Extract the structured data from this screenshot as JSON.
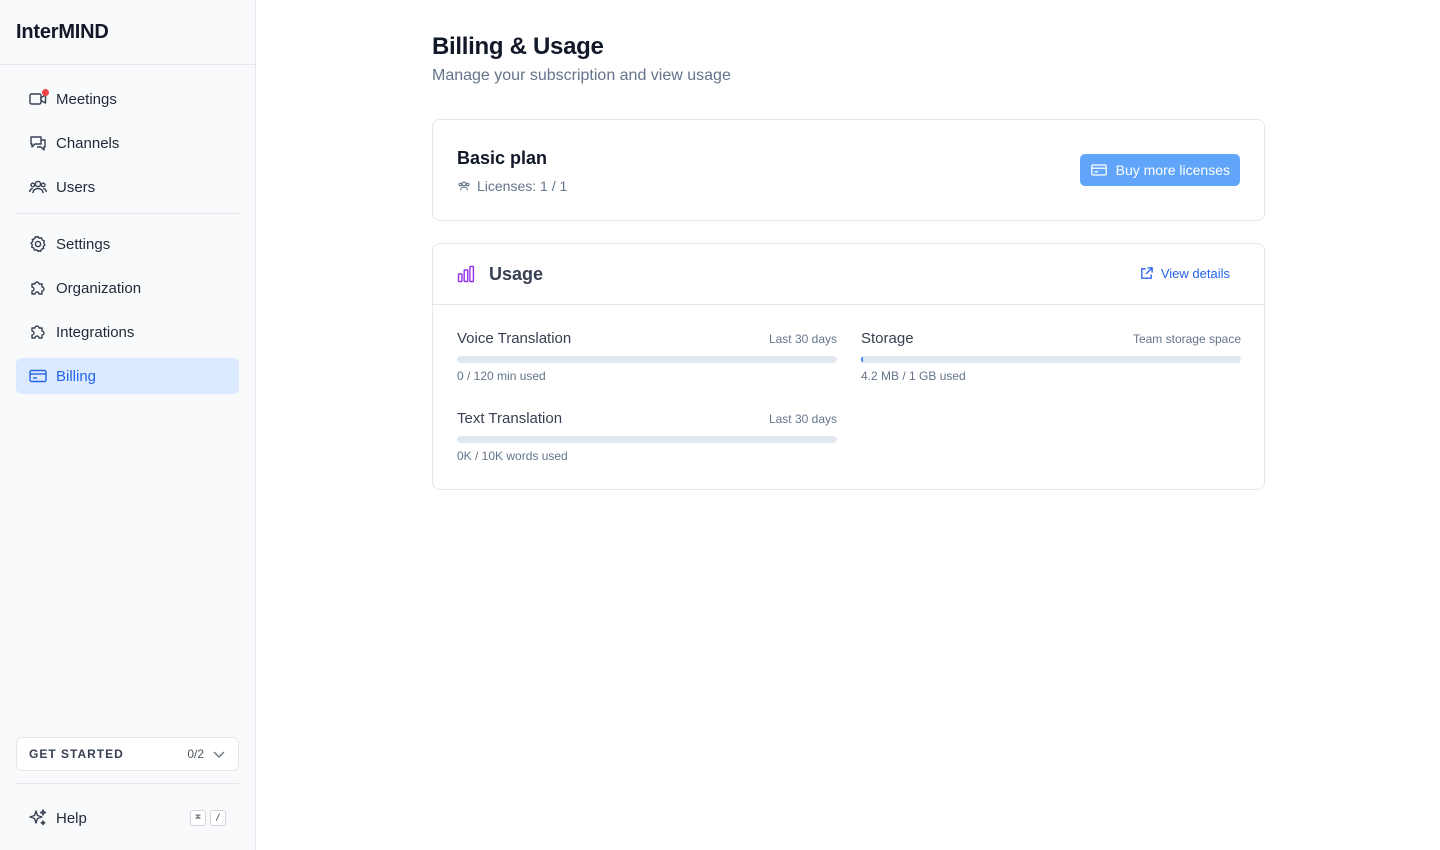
{
  "app": {
    "name": "InterMIND"
  },
  "sidebar": {
    "primary": [
      {
        "label": "Meetings",
        "icon": "video-camera-icon",
        "has_notification": true
      },
      {
        "label": "Channels",
        "icon": "chat-bubbles-icon"
      },
      {
        "label": "Users",
        "icon": "users-icon"
      }
    ],
    "secondary": [
      {
        "label": "Settings",
        "icon": "gear-icon"
      },
      {
        "label": "Organization",
        "icon": "puzzle-icon"
      },
      {
        "label": "Integrations",
        "icon": "puzzle-icon"
      },
      {
        "label": "Billing",
        "icon": "credit-card-icon",
        "active": true
      }
    ],
    "get_started": {
      "label": "GET STARTED",
      "count": "0/2"
    },
    "help": {
      "label": "Help",
      "shortcut_keys": [
        "⌘",
        "/"
      ]
    }
  },
  "page": {
    "title": "Billing & Usage",
    "subtitle": "Manage your subscription and view usage"
  },
  "plan": {
    "name": "Basic plan",
    "licenses": "Licenses: 1 / 1",
    "buy_button": "Buy more licenses"
  },
  "usage": {
    "title": "Usage",
    "view_details": "View details",
    "metrics": [
      {
        "title": "Voice Translation",
        "period": "Last 30 days",
        "used_text": "0 / 120 min used",
        "fraction": 0
      },
      {
        "title": "Storage",
        "period": "Team storage space",
        "used_text": "4.2 MB / 1 GB used",
        "fraction": 0.0041
      },
      {
        "title": "Text Translation",
        "period": "Last 30 days",
        "used_text": "0K / 10K words used",
        "fraction": 0
      }
    ]
  },
  "colors": {
    "accent": "#2563eb",
    "button": "#60a5fa",
    "active_bg": "#dbeafe",
    "notification": "#ef4444",
    "usage_icon": "#9333ea"
  }
}
